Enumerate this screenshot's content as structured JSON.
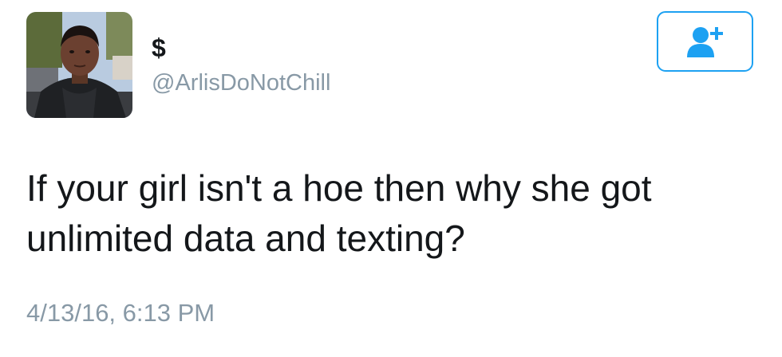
{
  "user": {
    "display_name": "$",
    "handle": "@ArlisDoNotChill"
  },
  "follow_button": {
    "icon": "add-user-icon",
    "accent_color": "#1da1f2"
  },
  "tweet": {
    "text": "If your girl isn't a hoe then why she got unlimited data and texting?",
    "timestamp": "4/13/16, 6:13 PM"
  },
  "colors": {
    "text": "#14171a",
    "secondary": "#8899a6",
    "accent": "#1da1f2"
  }
}
